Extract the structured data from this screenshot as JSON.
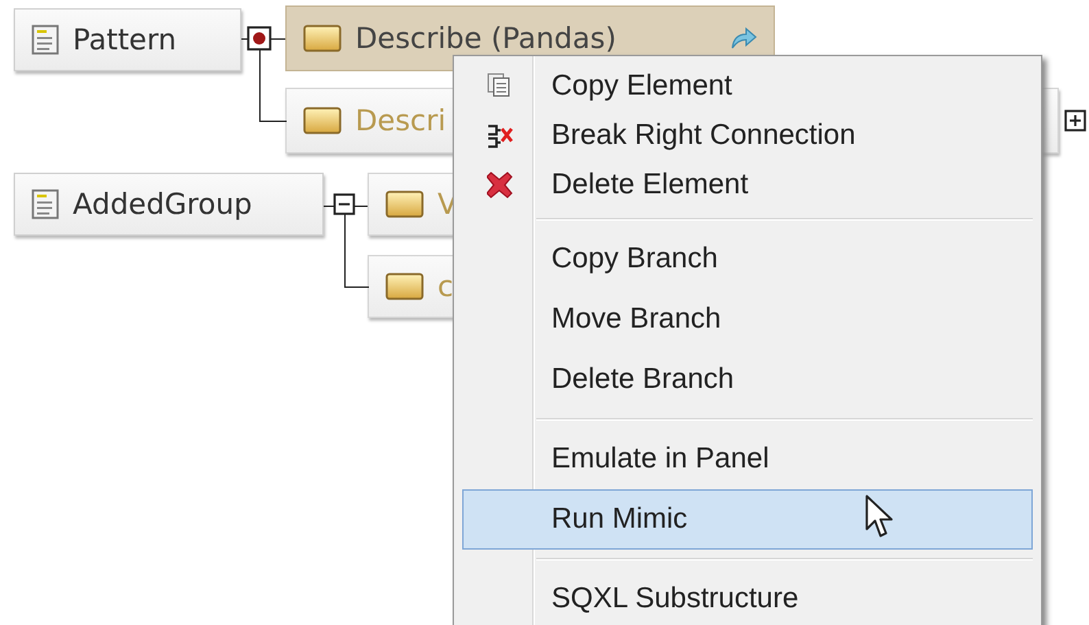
{
  "tree": [
    {
      "label": "Pattern",
      "kind": "dot",
      "children": [
        {
          "label": "Describe (Pandas)",
          "selected": true,
          "dimmed": false,
          "kind": "linked"
        },
        {
          "label": "Descri",
          "selected": false,
          "dimmed": true,
          "kind": "expandable"
        }
      ]
    },
    {
      "label": "AddedGroup",
      "kind": "minus",
      "children": [
        {
          "label": "V",
          "selected": false,
          "dimmed": true,
          "kind": "plain"
        },
        {
          "label": "c",
          "selected": false,
          "dimmed": true,
          "kind": "plain"
        }
      ]
    }
  ],
  "menu": {
    "sections": [
      {
        "items": [
          {
            "label": "Copy Element",
            "kind": "copy",
            "selected": false
          },
          {
            "label": "Break Right Connection",
            "kind": "break",
            "selected": false
          },
          {
            "label": "Delete Element",
            "kind": "delete",
            "selected": false
          }
        ]
      },
      {
        "items": [
          {
            "label": "Copy Branch",
            "kind": "plain",
            "selected": false
          },
          {
            "label": "Move Branch",
            "kind": "plain",
            "selected": false
          },
          {
            "label": "Delete Branch",
            "kind": "plain",
            "selected": false
          }
        ]
      },
      {
        "items": [
          {
            "label": "Emulate in Panel",
            "kind": "plain",
            "selected": false
          },
          {
            "label": "Run Mimic",
            "kind": "plain",
            "selected": true
          }
        ]
      },
      {
        "items": [
          {
            "label": "SQXL Substructure",
            "kind": "plain",
            "selected": false
          }
        ]
      }
    ]
  }
}
